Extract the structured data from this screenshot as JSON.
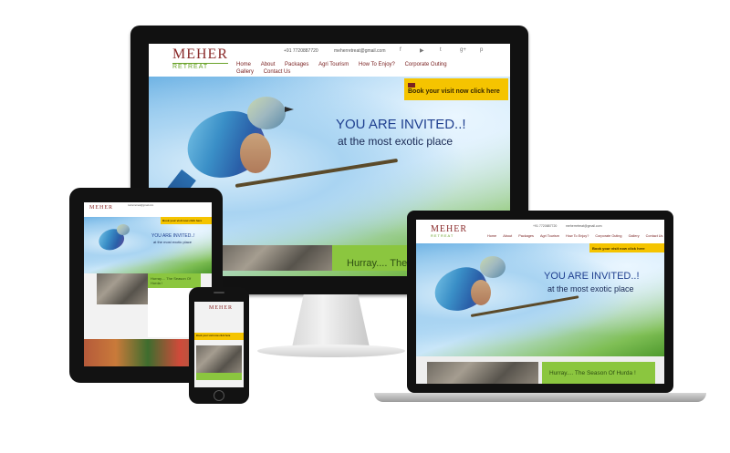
{
  "brand": {
    "name": "MEHER",
    "tagline": "RETREAT"
  },
  "header": {
    "phone": "+91 7720887720",
    "email": "meherretreat@gmail.com"
  },
  "social": [
    "facebook-icon",
    "youtube-icon",
    "twitter-icon",
    "google-plus-icon",
    "pinterest-icon"
  ],
  "nav": {
    "items": [
      "Home",
      "About",
      "Packages",
      "Agri Tourism",
      "How To Enjoy?",
      "Corporate Outing",
      "Gallery",
      "Contact Us"
    ]
  },
  "cta": {
    "label": "Book your visit now click here"
  },
  "hero": {
    "headline": "YOU ARE INVITED..!",
    "subline": "at the most exotic place"
  },
  "feature": {
    "title": "Hurray.... The Season Of Hurda !",
    "title_short": "Hurray.... The"
  },
  "tablet": {
    "feature_title": "Hurray.... The Season Of Hurda !"
  },
  "colors": {
    "brand_red": "#8a2a2a",
    "brand_green": "#6aa32a",
    "cta_yellow": "#f5c400",
    "headline_blue": "#1f3f8f",
    "feature_green": "#8bc63f"
  }
}
